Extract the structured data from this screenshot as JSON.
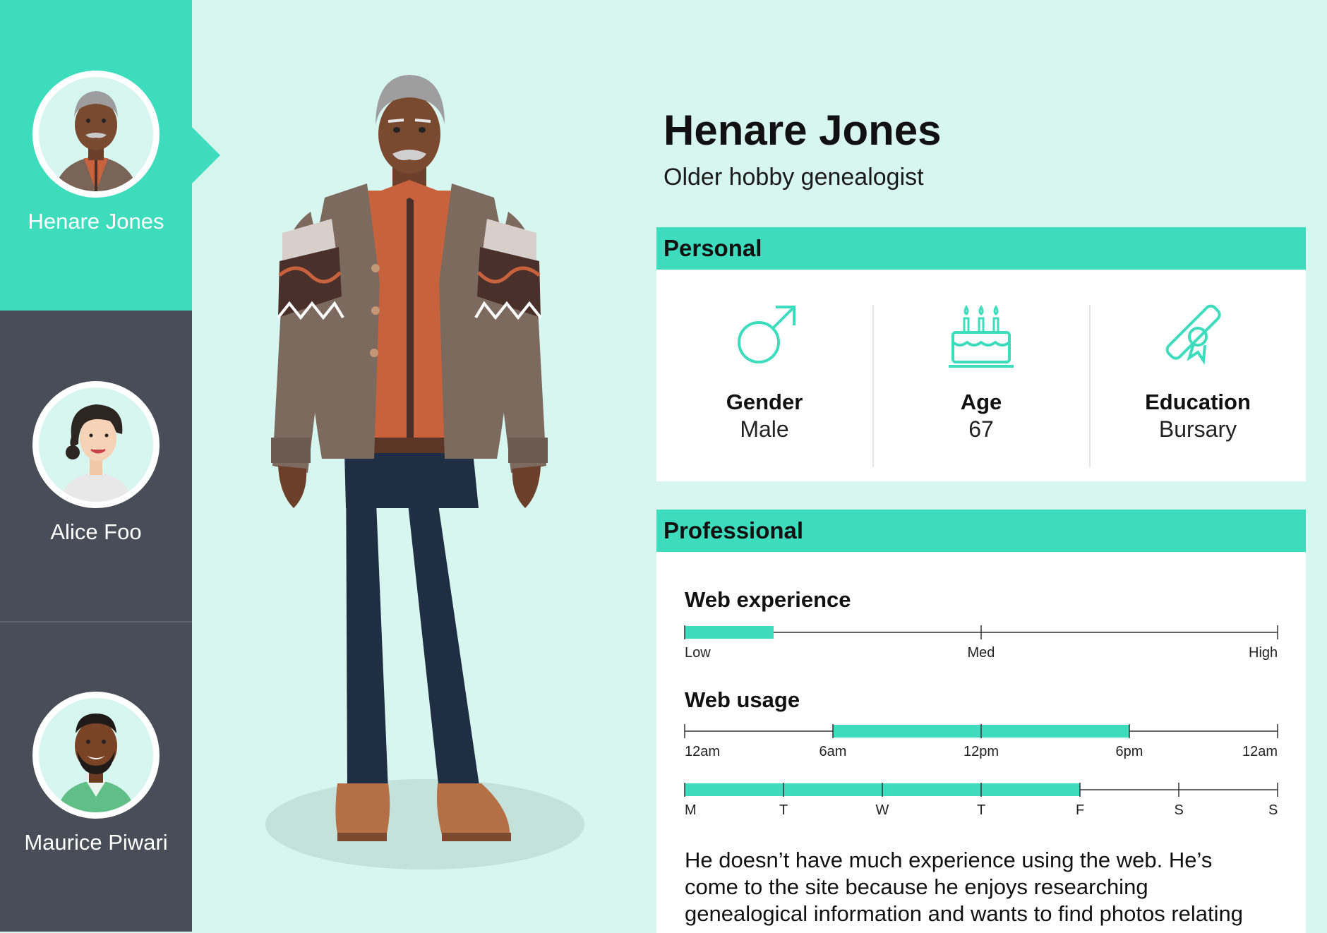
{
  "sidebar": {
    "personas": [
      {
        "name": "Henare Jones",
        "active": true
      },
      {
        "name": "Alice Foo",
        "active": false
      },
      {
        "name": "Maurice Piwari",
        "active": false
      }
    ]
  },
  "profile": {
    "name": "Henare Jones",
    "subtitle": "Older hobby genealogist"
  },
  "personal": {
    "heading": "Personal",
    "stats": [
      {
        "label": "Gender",
        "value": "Male",
        "icon": "male-icon"
      },
      {
        "label": "Age",
        "value": "67",
        "icon": "birthday-cake-icon"
      },
      {
        "label": "Education",
        "value": "Bursary",
        "icon": "diploma-icon"
      }
    ]
  },
  "professional": {
    "heading": "Professional",
    "web_experience": {
      "title": "Web experience",
      "labels": [
        "Low",
        "Med",
        "High"
      ],
      "level": 0.15
    },
    "web_usage": {
      "title": "Web usage",
      "time_labels": [
        "12am",
        "6am",
        "12pm",
        "6pm",
        "12am"
      ],
      "time_range": [
        "6am",
        "6pm"
      ],
      "day_labels": [
        "M",
        "T",
        "W",
        "T",
        "F",
        "S",
        "S"
      ],
      "active_days": [
        "M",
        "T",
        "W",
        "T",
        "F"
      ]
    },
    "bio": "He doesn’t have much experience using the web. He’s come to the site because he enjoys researching genealogical information and wants to find photos relating"
  },
  "colors": {
    "accent": "#3ddcbd",
    "sidebar": "#484d57",
    "background": "#d7f6f0"
  }
}
